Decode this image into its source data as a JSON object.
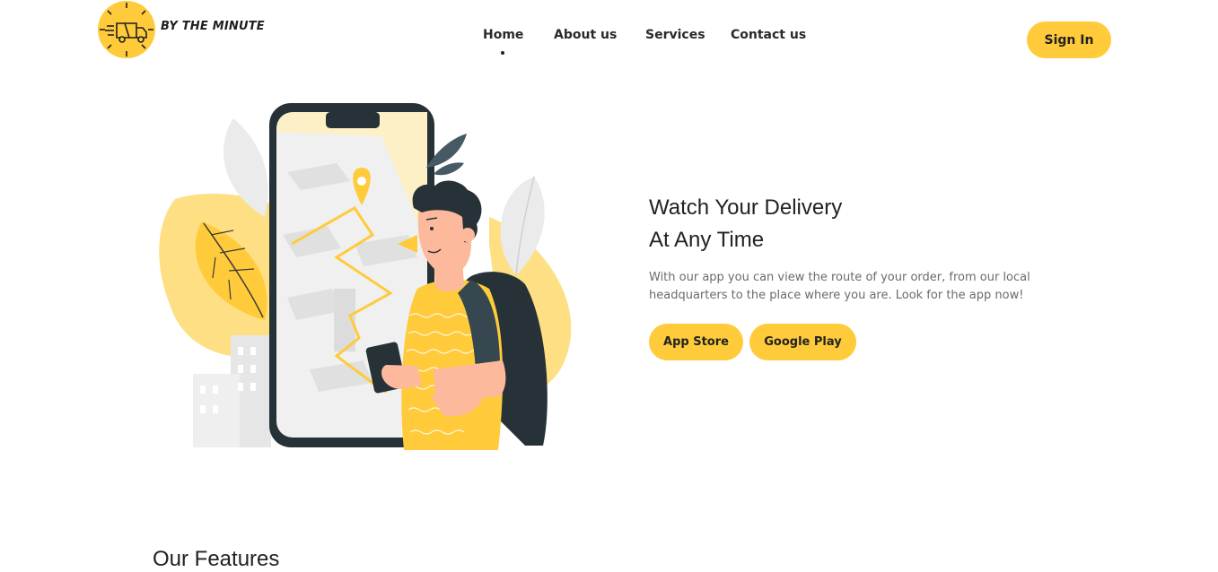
{
  "brand": {
    "name": "BY THE MINUTE",
    "logo_icon": "delivery-truck-clock-icon",
    "accent_color": "#FFCB3A"
  },
  "nav": {
    "items": [
      {
        "label": "Home",
        "active": true
      },
      {
        "label": "About us",
        "active": false
      },
      {
        "label": "Services",
        "active": false
      },
      {
        "label": "Contact us",
        "active": false
      }
    ]
  },
  "header": {
    "signin_label": "Sign In"
  },
  "hero": {
    "title_line1": "Watch Your Delivery",
    "title_line2": "At Any Time",
    "description_line1": "With our app you can view the route of your order, from our local",
    "description_line2": "headquarters to the place where you are. Look for the app now!",
    "buttons": {
      "app_store": "App Store",
      "google_play": "Google Play"
    },
    "illustration": "delivery-tracking-illustration"
  },
  "next_section": {
    "title": "Our Features"
  }
}
